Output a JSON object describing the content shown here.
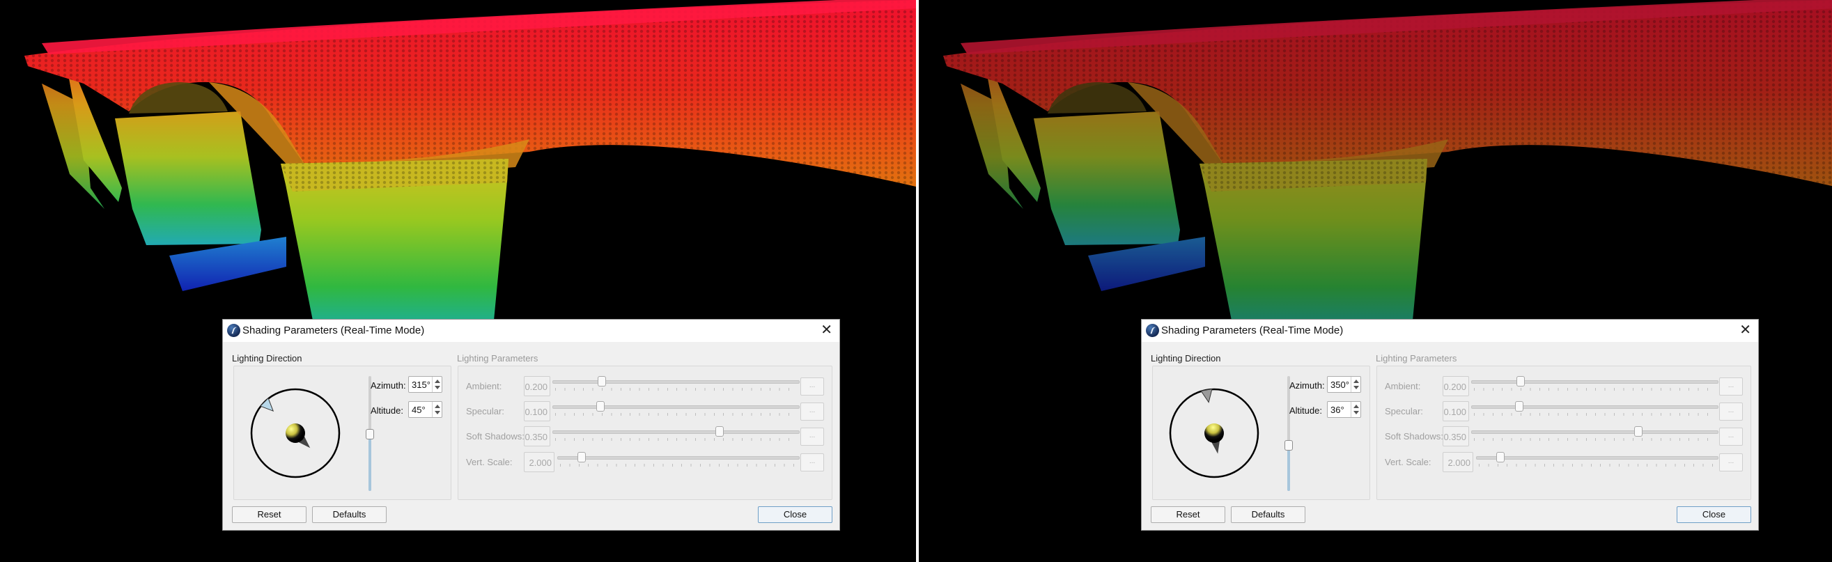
{
  "panels": [
    {
      "dialog": {
        "title": "Shading Parameters (Real-Time Mode)",
        "close_icon": "close-icon",
        "lighting_direction": {
          "label": "Lighting Direction",
          "azimuth_label": "Azimuth:",
          "azimuth_value": "315°",
          "azimuth_deg": 315,
          "altitude_label": "Altitude:",
          "altitude_value": "45°",
          "altitude_deg": 45
        },
        "lighting_parameters": {
          "label": "Lighting Parameters",
          "rows": [
            {
              "label": "Ambient:",
              "value": "0.200",
              "slider_fraction": 0.2,
              "more": "..."
            },
            {
              "label": "Specular:",
              "value": "0.100",
              "slider_fraction": 0.195,
              "more": "..."
            },
            {
              "label": "Soft Shadows:",
              "value": "0.350",
              "slider_fraction": 0.68,
              "more": "..."
            },
            {
              "label": "Vert. Scale:",
              "value": "2.000",
              "slider_fraction": 0.1,
              "more": "..."
            }
          ]
        },
        "buttons": {
          "reset": "Reset",
          "defaults": "Defaults",
          "close": "Close"
        },
        "marker_color": "#b8d8ea"
      }
    },
    {
      "dialog": {
        "title": "Shading Parameters (Real-Time Mode)",
        "close_icon": "close-icon",
        "lighting_direction": {
          "label": "Lighting Direction",
          "azimuth_label": "Azimuth:",
          "azimuth_value": "350°",
          "azimuth_deg": 350,
          "altitude_label": "Altitude:",
          "altitude_value": "36°",
          "altitude_deg": 36
        },
        "lighting_parameters": {
          "label": "Lighting Parameters",
          "rows": [
            {
              "label": "Ambient:",
              "value": "0.200",
              "slider_fraction": 0.2,
              "more": "..."
            },
            {
              "label": "Specular:",
              "value": "0.100",
              "slider_fraction": 0.195,
              "more": "..."
            },
            {
              "label": "Soft Shadows:",
              "value": "0.350",
              "slider_fraction": 0.68,
              "more": "..."
            },
            {
              "label": "Vert. Scale:",
              "value": "2.000",
              "slider_fraction": 0.1,
              "more": "..."
            }
          ]
        },
        "buttons": {
          "reset": "Reset",
          "defaults": "Defaults",
          "close": "Close"
        },
        "marker_color": "#9a9a9a"
      }
    }
  ]
}
